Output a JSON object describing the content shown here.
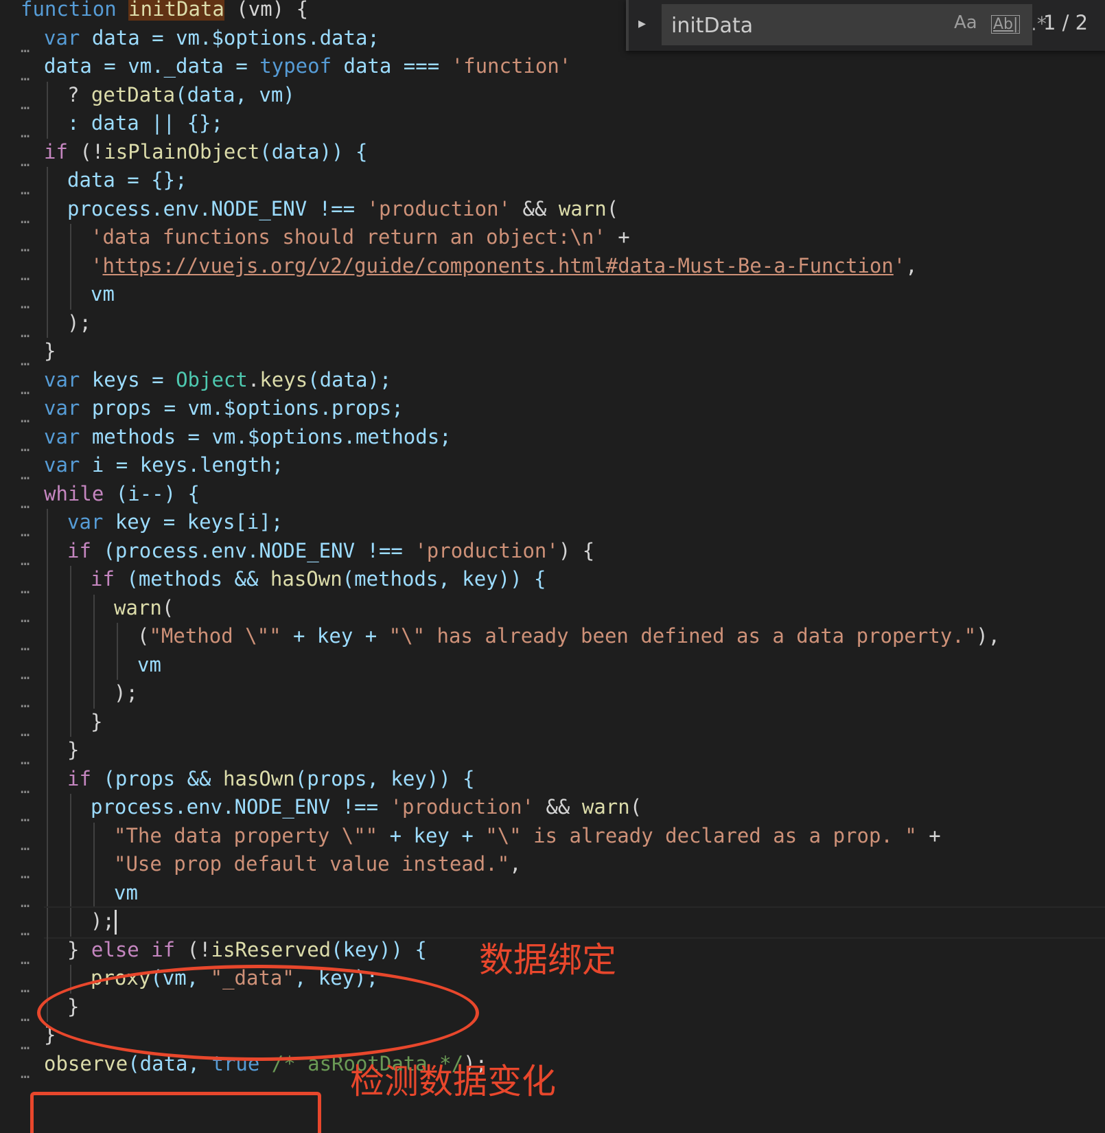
{
  "find_widget": {
    "query": "initData",
    "match_case_label": "Aa",
    "whole_word_label": "Ab|",
    "regex_label": ".*",
    "match_count": "1 / 2",
    "toggle_icon": "chevron-right-icon"
  },
  "annotations": {
    "data_binding": "数据绑定",
    "detect_changes": "检测数据变化"
  },
  "code": {
    "fold_marker": "…",
    "l01": [
      "function",
      " ",
      "initData",
      " (vm) {"
    ],
    "l02": [
      "var",
      " data = vm.$options.data;"
    ],
    "l03": [
      "data = vm._data = ",
      "typeof",
      " data === ",
      "'function'"
    ],
    "l04": [
      "? ",
      "getData",
      "(data, vm)"
    ],
    "l05": [
      ": data || {};"
    ],
    "l06": [
      "if",
      " (!",
      "isPlainObject",
      "(data)) {"
    ],
    "l07": [
      "data = {};"
    ],
    "l08": [
      "process.env.NODE_ENV !== ",
      "'production'",
      " && ",
      "warn",
      "("
    ],
    "l09": [
      "'data functions should return an object:\\n'",
      " +"
    ],
    "l10": [
      "'",
      "https://vuejs.org/v2/guide/components.html#data-Must-Be-a-Function",
      "'",
      ","
    ],
    "l11": [
      "vm"
    ],
    "l12": [
      ");"
    ],
    "l13": [
      "}"
    ],
    "l14": [
      "var",
      " keys = ",
      "Object",
      ".",
      "keys",
      "(data);"
    ],
    "l15": [
      "var",
      " props = vm.$options.props;"
    ],
    "l16": [
      "var",
      " methods = vm.$options.methods;"
    ],
    "l17": [
      "var",
      " i = keys.length;"
    ],
    "l18": [
      "while",
      " (i--) {"
    ],
    "l19": [
      "var",
      " key = keys[i];"
    ],
    "l20": [
      "if",
      " (process.env.NODE_ENV !== ",
      "'production'",
      ") {"
    ],
    "l21": [
      "if",
      " (methods && ",
      "hasOwn",
      "(methods, key)) {"
    ],
    "l22": [
      "warn",
      "("
    ],
    "l23": [
      "(",
      "\"Method \\\"\"",
      " + key + ",
      "\"\\\" has already been defined as a data property.\"",
      "),"
    ],
    "l24": [
      "vm"
    ],
    "l25": [
      ");"
    ],
    "l26": [
      "}"
    ],
    "l27": [
      "}"
    ],
    "l28": [
      "if",
      " (props && ",
      "hasOwn",
      "(props, key)) {"
    ],
    "l29": [
      "process.env.NODE_ENV !== ",
      "'production'",
      " && ",
      "warn",
      "("
    ],
    "l30": [
      "\"The data property \\\"\"",
      " + key + ",
      "\"\\\" is already declared as a prop. \"",
      " +"
    ],
    "l31": [
      "\"Use prop default value instead.\"",
      ","
    ],
    "l32": [
      "vm"
    ],
    "l33": [
      ");"
    ],
    "l34": [
      "} ",
      "else if",
      " (!",
      "isReserved",
      "(key)) {"
    ],
    "l35": [
      "proxy",
      "(vm, ",
      "\"_data\"",
      ", key);"
    ],
    "l36": [
      "}"
    ],
    "l37": [
      "}"
    ],
    "l38": [
      "observe",
      "(data, ",
      "true",
      " ",
      "/* asRootData */",
      ");"
    ]
  }
}
